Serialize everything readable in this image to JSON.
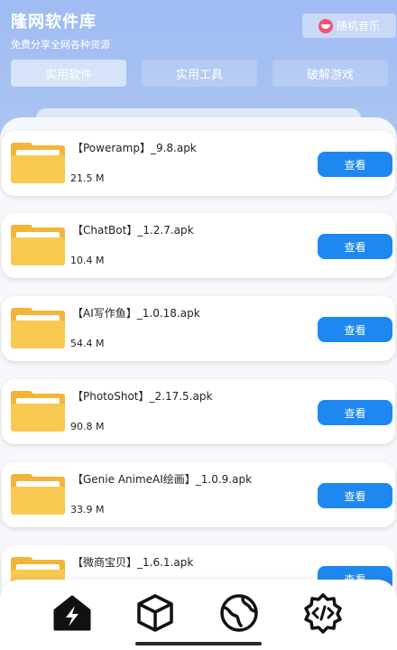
{
  "header": {
    "title": "隆网软件库",
    "subtitle": "免费分享全网各种资源",
    "music_button": "随机音乐"
  },
  "tabs": [
    {
      "label": "实用软件",
      "active": true
    },
    {
      "label": "实用工具",
      "active": false
    },
    {
      "label": "破解游戏",
      "active": false
    }
  ],
  "files": [
    {
      "name": "【Poweramp】_9.8.apk",
      "size": "21.5 M",
      "action": "查看"
    },
    {
      "name": "【ChatBot】_1.2.7.apk",
      "size": "10.4 M",
      "action": "查看"
    },
    {
      "name": "【AI写作鱼】_1.0.18.apk",
      "size": "54.4 M",
      "action": "查看"
    },
    {
      "name": "【PhotoShot】_2.17.5.apk",
      "size": "90.8 M",
      "action": "查看"
    },
    {
      "name": "【Genie AnimeAI绘画】_1.0.9.apk",
      "size": "33.9 M",
      "action": "查看"
    },
    {
      "name": "【微商宝贝】_1.6.1.apk",
      "size": "",
      "action": "查看"
    }
  ],
  "nav": [
    {
      "icon": "home-bolt-icon",
      "active": true
    },
    {
      "icon": "cube-icon",
      "active": false
    },
    {
      "icon": "globe-icon",
      "active": false
    },
    {
      "icon": "code-gear-icon",
      "active": false
    }
  ],
  "colors": {
    "accent": "#1e88f0",
    "header_top": "#9fbcf3",
    "folder": "#f8c951",
    "music_icon": "#f0566e"
  }
}
